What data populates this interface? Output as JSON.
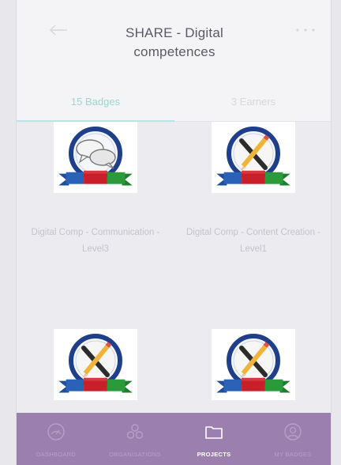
{
  "header": {
    "title": "SHARE - Digital competences",
    "back_icon": "arrow-left-icon",
    "more_icon": "more-dots-icon"
  },
  "tabs": [
    {
      "label": "15 Badges",
      "active": true
    },
    {
      "label": "3 Earners",
      "active": false
    }
  ],
  "badges": [
    {
      "label": "Digital Comp - Communication - Level3",
      "icon": "speech-bubbles-badge-icon"
    },
    {
      "label": "Digital Comp - Content Creation - Level1",
      "icon": "pencil-cross-badge-icon"
    },
    {
      "label": "",
      "icon": "pencil-cross-badge-icon"
    },
    {
      "label": "",
      "icon": "pencil-cross-badge-icon"
    }
  ],
  "nav": [
    {
      "label": "DASHBOARD",
      "icon": "dashboard-icon",
      "active": false
    },
    {
      "label": "ORGANISATIONS",
      "icon": "organisations-icon",
      "active": false
    },
    {
      "label": "PROJECTS",
      "icon": "folder-icon",
      "active": true
    },
    {
      "label": "MY BADGES",
      "icon": "profile-icon",
      "active": false
    }
  ],
  "colors": {
    "accent": "#9ad6d6",
    "nav_background": "#9b7fae",
    "ribbon": [
      "#2a62b8",
      "#c8202a",
      "#2a9a3a"
    ]
  }
}
